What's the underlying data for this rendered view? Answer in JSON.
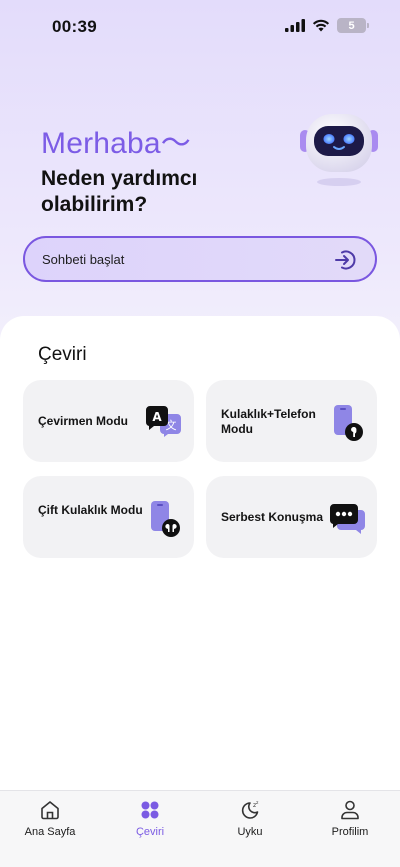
{
  "status_bar": {
    "time": "00:39",
    "battery": "5"
  },
  "hero": {
    "greeting": "Merhaba～",
    "subtitle": "Neden yardımcı olabilirim?",
    "mascot_icon": "robot-mascot-icon"
  },
  "chat_start": {
    "label": "Sohbeti başlat",
    "icon": "arrow-right-circle-icon"
  },
  "translate_section": {
    "title": "Çeviri",
    "modes": [
      {
        "label": "Çevirmen Modu",
        "icon": "translate-bubbles-icon"
      },
      {
        "label": "Kulaklık+Telefon Modu",
        "icon": "phone-earbud-icon"
      },
      {
        "label": "Çift Kulaklık Modu",
        "icon": "phone-earbuds-icon"
      },
      {
        "label": "Serbest Konuşma",
        "icon": "chat-bubbles-icon"
      }
    ]
  },
  "bottom_nav": {
    "items": [
      {
        "label": "Ana Sayfa",
        "icon": "home-icon",
        "active": false
      },
      {
        "label": "Çeviri",
        "icon": "grid-icon",
        "active": true
      },
      {
        "label": "Uyku",
        "icon": "moon-icon",
        "active": false
      },
      {
        "label": "Profilim",
        "icon": "user-icon",
        "active": false
      }
    ]
  },
  "colors": {
    "accent": "#7B5BE3",
    "card_bg": "#F2F2F4",
    "hero_top": "#E3DCFB"
  }
}
